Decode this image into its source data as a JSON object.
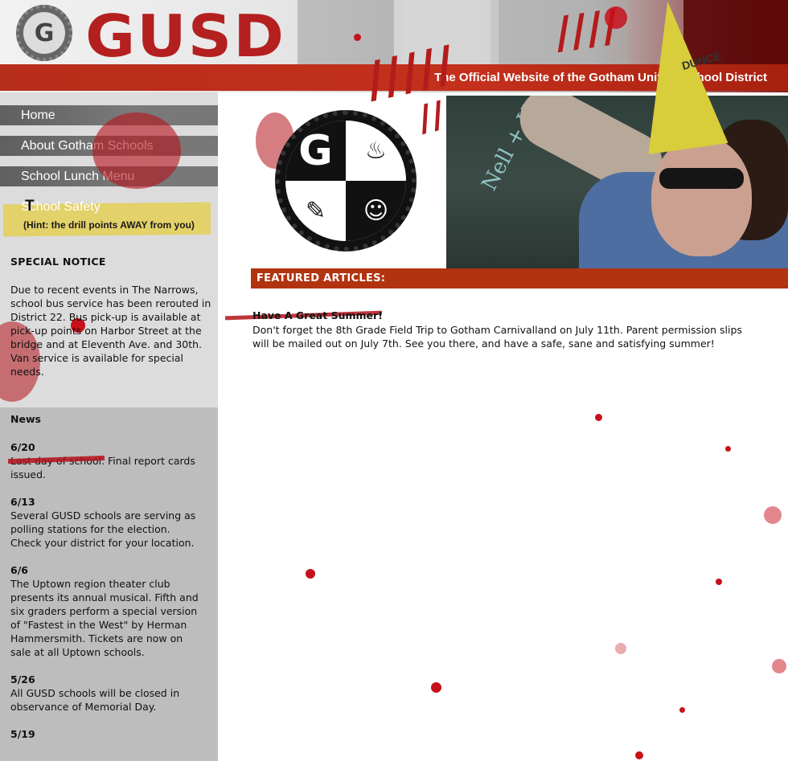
{
  "header": {
    "brand": "GUSD",
    "seal_letter": "G",
    "tagline": "The Official Website of the Gotham Unified School District"
  },
  "nav": {
    "items": [
      {
        "label": "Home"
      },
      {
        "label": "About Gotham Schools"
      },
      {
        "label": "School Lunch Menu"
      },
      {
        "label": "School Safety"
      }
    ],
    "safety_T": "T",
    "safety_hint": "(Hint: the drill points AWAY from you)"
  },
  "notice": {
    "title": "SPECIAL NOTICE",
    "body": "Due to recent events in The Narrows, school bus service has been rerouted in District 22. Bus pick-up is available at pick-up points on Harbor Street at the bridge and at Eleventh Ave. and 30th. Van service is available for special needs."
  },
  "news": {
    "title": "News",
    "items": [
      {
        "date": "6/20",
        "text": "Last day of school. Final report cards issued."
      },
      {
        "date": "6/13",
        "text": "Several GUSD schools are serving as polling stations for the election. Check your district for your location."
      },
      {
        "date": "6/6",
        "text": "The Uptown region theater club presents its annual musical. Fifth and six graders perform a special version of \"Fastest in the West\" by Herman Hammersmith. Tickets are now on sale at all Uptown schools."
      },
      {
        "date": "5/26",
        "text": "All GUSD schools will be closed in observance of Memorial Day."
      },
      {
        "date": "5/19",
        "text": ""
      }
    ]
  },
  "hero": {
    "seal_letter": "G",
    "chalk_text": "Nell + Hyl",
    "dunce_label": "DUNCE"
  },
  "featured": {
    "title": "FEATURED ARTICLES:",
    "article_title": "Have A Great Summer!",
    "article_body": "Don't forget the 8th Grade Field Trip to Gotham Carnivalland on July 11th. Parent permission slips will be mailed out on July 7th. See you there, and have a safe, sane and satisfying summer!"
  },
  "colors": {
    "brand_red": "#b4201f",
    "featured_bar": "#b23310",
    "sidebar_top": "#dcdcdc",
    "sidebar_bottom": "#bdbdbd",
    "nav_bg": "#6b6b6b"
  }
}
